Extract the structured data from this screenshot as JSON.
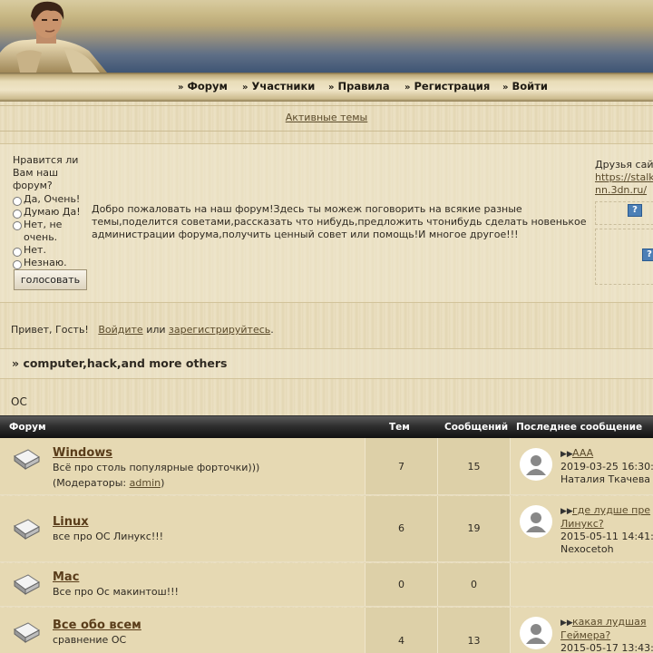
{
  "nav": {
    "items": [
      {
        "label": "Форум"
      },
      {
        "label": "Участники"
      },
      {
        "label": "Правила"
      },
      {
        "label": "Регистрация"
      },
      {
        "label": "Войти"
      }
    ],
    "arrow": "»"
  },
  "active_topics": "Активные темы",
  "poll": {
    "question": "Нравится ли Вам наш форум?",
    "options": [
      "Да, Очень!",
      "Думаю Да!",
      "Нет, не очень.",
      "Нет.",
      "Незнаю."
    ],
    "button": "голосовать"
  },
  "welcome": "Добро пожаловать на наш форум!Здесь ты можеж поговорить на всякие разные темы,поделится советами,рассказать что нибудь,предложить чтонибудь сделать новенькое администрации форума,получить ценный совет или помощь!И многое другое!!!",
  "friends": {
    "title": "Друзья сай",
    "link_line1": "https://stalk",
    "link_line2": "nn.3dn.ru/",
    "help": "?"
  },
  "greeting": {
    "text_prefix": "Привет, Гость!",
    "login": "Войдите",
    "or": "или",
    "register": "зарегистрируйтесь",
    "end": "."
  },
  "category": {
    "arrow": "»",
    "title": "computer,hack,and more others"
  },
  "section": "ОС",
  "table": {
    "headers": {
      "forum": "Форум",
      "topics": "Тем",
      "posts": "Сообщений",
      "last": "Последнее сообщение"
    },
    "rows": [
      {
        "title": "Windows",
        "desc": "Всё про столь популярные форточки)))",
        "moderators_prefix": "(Модераторы: ",
        "moderator": "admin",
        "moderators_suffix": ")",
        "topics": "7",
        "posts": "15",
        "last_title": "AAA",
        "last_title2": "",
        "last_date": "2019-03-25 16:30:",
        "last_user": "Наталия Ткачева"
      },
      {
        "title": "Linux",
        "desc": "все про ОС Линукс!!!",
        "topics": "6",
        "posts": "19",
        "last_title": "где лудше пре",
        "last_title2": "Линукс?",
        "last_date": "2015-05-11 14:41:",
        "last_user": "Nexocetoh"
      },
      {
        "title": "Mac",
        "desc": "Все про Ос макинтош!!!",
        "topics": "0",
        "posts": "0"
      },
      {
        "title": "Все обо всем",
        "desc": "сравнение ОС",
        "topics": "4",
        "posts": "13",
        "last_title": "какая лудшая",
        "last_title2": "Геймера?",
        "last_date": "2015-05-17 13:43:"
      }
    ]
  }
}
